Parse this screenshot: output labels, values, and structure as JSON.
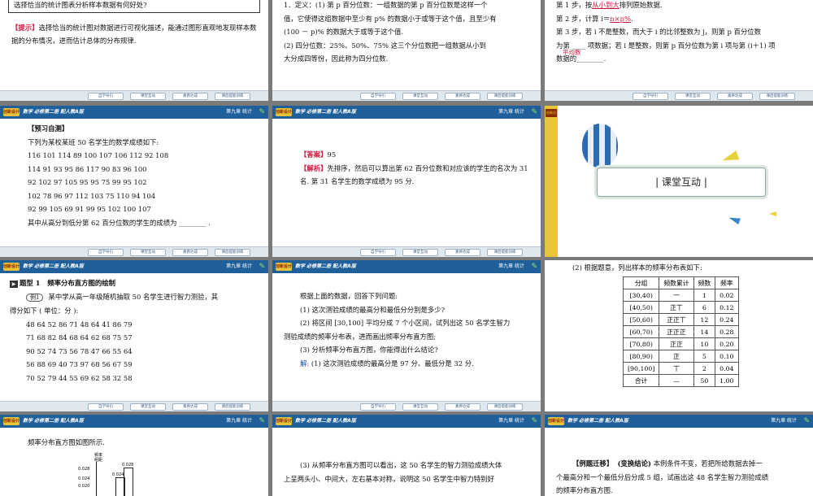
{
  "header": {
    "logo": "创新设计",
    "subject": "数学  必修第二册  配人教A版",
    "chapter": "第九章  统计"
  },
  "footer": {
    "nav": [
      "自学导引",
      "课堂互动",
      "素养达成",
      "课后提能训练"
    ]
  },
  "s1": {
    "line0": "选择恰当的统计图表分析样本数据有何好处?",
    "hint_label": "【提示】",
    "hint": "选择恰当的统计图对数据进行可视化描述，能通过图形直观地发现样本数据的分布情况，进而估计总体的分布规律."
  },
  "s2": {
    "lines": [
      "1．定义：(1) 第 p 百分位数：一组数据的第 p 百分位数是这样一个",
      "值，它使得这组数据中至少有 p% 的数据小于或等于这个值，且至少有",
      "(100 － p)% 的数据大于或等于这个值.",
      "(2) 四分位数：25%、50%、75% 这三个分位数把一组数据从小到",
      "大分成四等份，因此称为四分位数."
    ]
  },
  "s3": {
    "step1a": "第 1 步，按",
    "step1fill": "从小到大",
    "step1b": "排列原始数据.",
    "step2a": "第 2 步，计算 i＝",
    "step2fill": "n×p%",
    "step2b": ".",
    "step3a": "第 3 步，若 i 不是整数，而大于 i 的比邻整数为 j，则第 p 百分位数",
    "step3b": "为第 ____ 项数据；若 i 是整数，则第 p 百分位数为第 i 项与第 (i＋1) 项",
    "step3fill": "平均数",
    "step3c": "数据的________."
  },
  "s4": {
    "title": "【预习自测】",
    "intro": "下列为某校某班 50 名学生的数学成绩如下:",
    "rows": [
      "116 101 114 89 100 107 106 112 92 108",
      "114 91 93 95 86 117 90 83 96 100",
      "92 102 97 105 95 95 75 99 95 102",
      "102 78 96 97 112 103 75 110 94 104",
      "92 99 105 69 91 99 95 102 100 107"
    ],
    "question": "其中从高分到低分第 62 百分位数的学生的成绩为 ________ ."
  },
  "s5": {
    "ans_label": "【答案】",
    "ans": "95",
    "exp_label": "【解析】",
    "exp": "先排序，然后可以算出第 62 百分位数和对应该的学生的名次为 31 名. 第 31 名学生的数学成绩为 95 分."
  },
  "s6": {
    "title": "|   课堂互动   |"
  },
  "s7": {
    "type_label": "题型 1",
    "type_title": "频率分布直方图的绘制",
    "ex_label": "例1",
    "ex_text": "某中学从高一年级随机抽取 50 名学生进行智力测验，其",
    "ex_text2": "得分如下 ( 单位：分 ):",
    "rows": [
      "48 64 52 86 71 48 64 41 86 79",
      "71 68 82 84 68 64 62 68 75 57",
      "90 52 74 73 56 78 47 66 55 64",
      "56 88 69 40 73 97 68 56 67 59",
      "70 52 79 44 55 69 62 58 32 58"
    ]
  },
  "s8": {
    "l1": "根据上面的数据，回答下列问题:",
    "l2": "(1) 这次测验成绩的最高分和最低分分别是多少?",
    "l3": "(2) 将区间 [30,100] 平均分成 7 个小区间，试列出这 50 名学生智力",
    "l4": "测验成绩的频率分布表，进而画出频率分布直方图;",
    "l5": "(3) 分析频率分布直方图，你能得出什么结论?",
    "sol_label": "解:",
    "sol": "(1) 这次测验成绩的最高分是 97 分、最低分是 32 分."
  },
  "s9": {
    "intro": "(2) 根据题意，列出样本的频率分布表如下:",
    "cols": [
      "分组",
      "频数累计",
      "频数",
      "频率"
    ],
    "rows": [
      [
        "[30,40)",
        "一",
        "1",
        "0.02"
      ],
      [
        "[40,50)",
        "正丅",
        "6",
        "0.12"
      ],
      [
        "[50,60)",
        "正正丅",
        "12",
        "0.24"
      ],
      [
        "[60,70)",
        "正正正",
        "14",
        "0.28"
      ],
      [
        "[70,80)",
        "正正",
        "10",
        "0.20"
      ],
      [
        "[80,90)",
        "正",
        "5",
        "0.10"
      ],
      [
        "[90,100]",
        "丅",
        "2",
        "0.04"
      ],
      [
        "合计",
        "—",
        "50",
        "1.00"
      ]
    ]
  },
  "s10": {
    "intro": "频率分布直方图如图所示.",
    "ylab1": "频率",
    "ylab2": "组距",
    "yticks": [
      "0.028",
      "0.024",
      "0.020"
    ],
    "bar_labels": [
      "0.024",
      "0.028"
    ]
  },
  "s11": {
    "l1": "(3) 从频率分布直方图可以看出，这 50 名学生的智力测验成绩大体",
    "l2": "上呈两头小、中间大，左右基本对称，说明这 50 名学生中智力特别好"
  },
  "s12": {
    "label": "【例题迁移】",
    "tag": "(变换结论)",
    "l1": "本例条件不变，若把所给数据去掉一",
    "l2": "个最高分和一个最低分后分成 5 组，试画出这 48 名学生智力测验成绩",
    "l3": "的频率分布直方图."
  }
}
